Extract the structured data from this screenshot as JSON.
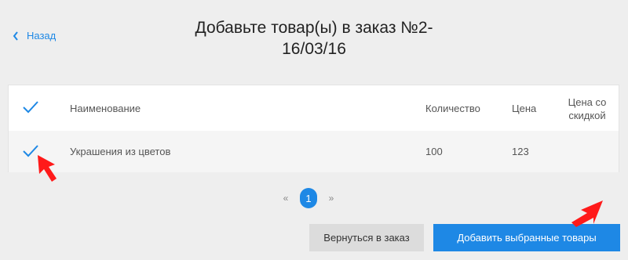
{
  "nav": {
    "back_label": "Назад"
  },
  "title": {
    "line1": "Добавьте товар(ы) в заказ №2-",
    "line2": "16/03/16"
  },
  "table": {
    "columns": {
      "name": "Наименование",
      "quantity": "Количество",
      "price": "Цена",
      "discount_price_line1": "Цена со",
      "discount_price_line2": "скидкой"
    },
    "rows": [
      {
        "name": "Украшения из цветов",
        "quantity": "100",
        "price": "123",
        "discount_price": ""
      }
    ]
  },
  "pagination": {
    "prev": "«",
    "current": "1",
    "next": "»"
  },
  "actions": {
    "return_label": "Вернуться в заказ",
    "add_selected_label": "Добавить выбранные товары"
  },
  "colors": {
    "accent": "#1e88e5",
    "annotation": "#ff1a1a"
  }
}
